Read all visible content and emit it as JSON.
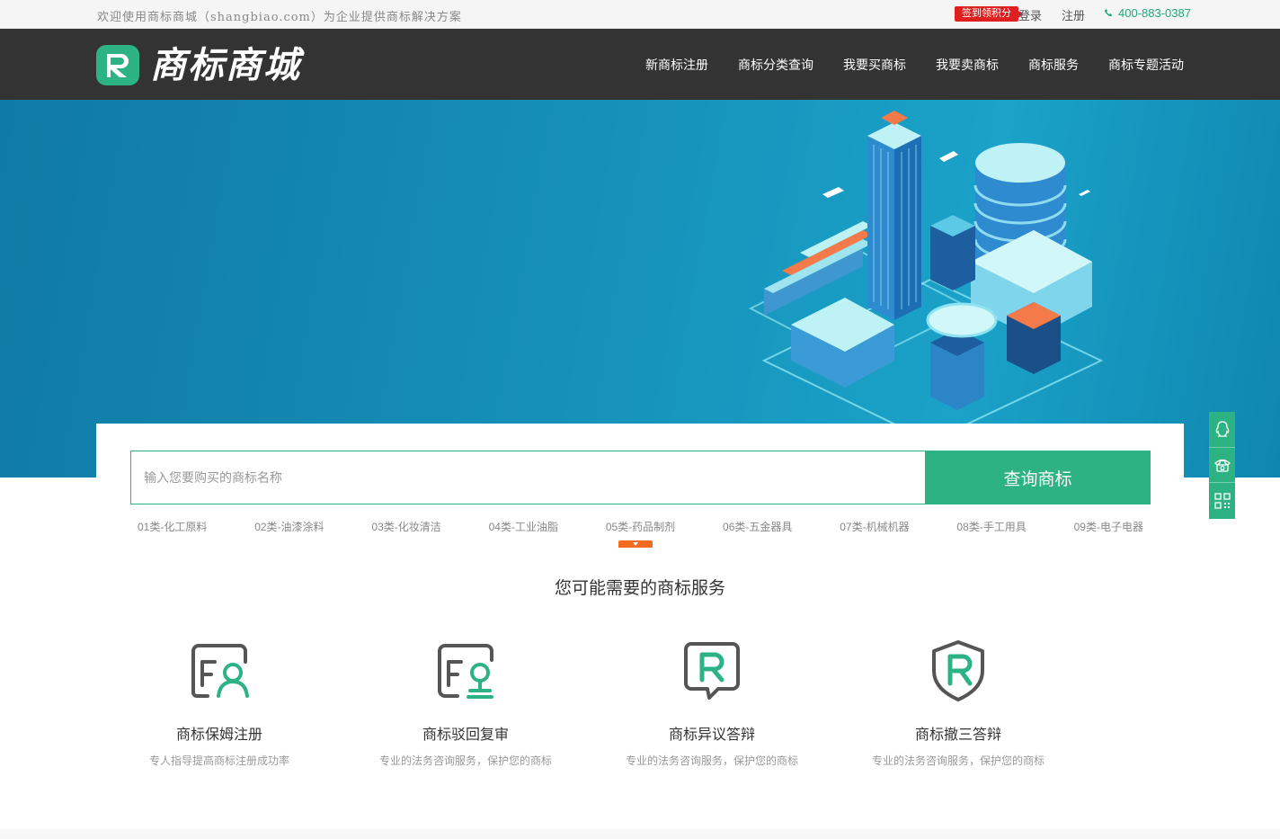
{
  "topbar": {
    "welcome": "欢迎使用商标商城（shangbiao.com）为企业提供商标解决方案",
    "signin_badge": "签到领积分",
    "login": "登录",
    "register": "注册",
    "phone": "400-883-0387"
  },
  "header": {
    "logo_text": "商标商城",
    "nav": [
      "新商标注册",
      "商标分类查询",
      "我要买商标",
      "我要卖商标",
      "商标服务",
      "商标专题活动"
    ]
  },
  "search": {
    "placeholder": "输入您要购买的商标名称",
    "button": "查询商标",
    "categories": [
      "01类-化工原料",
      "02类-油漆涂料",
      "03类-化妆清洁",
      "04类-工业油脂",
      "05类-药品制剂",
      "06类-五金器具",
      "07类-机械机器",
      "08类-手工用具",
      "09类-电子电器"
    ]
  },
  "services": {
    "title": "您可能需要的商标服务",
    "items": [
      {
        "name": "商标保姆注册",
        "desc": "专人指导提高商标注册成功率",
        "icon": "nanny-register-icon"
      },
      {
        "name": "商标驳回复审",
        "desc": "专业的法务咨询服务，保护您的商标",
        "icon": "rejection-review-icon"
      },
      {
        "name": "商标异议答辩",
        "desc": "专业的法务咨询服务，保护您的商标",
        "icon": "objection-reply-icon"
      },
      {
        "name": "商标撤三答辩",
        "desc": "专业的法务咨询服务，保护您的商标",
        "icon": "revocation-reply-icon"
      }
    ]
  },
  "colors": {
    "brand": "#2db383",
    "header": "#333333",
    "accent": "#f36a21",
    "badge": "#e02020"
  }
}
